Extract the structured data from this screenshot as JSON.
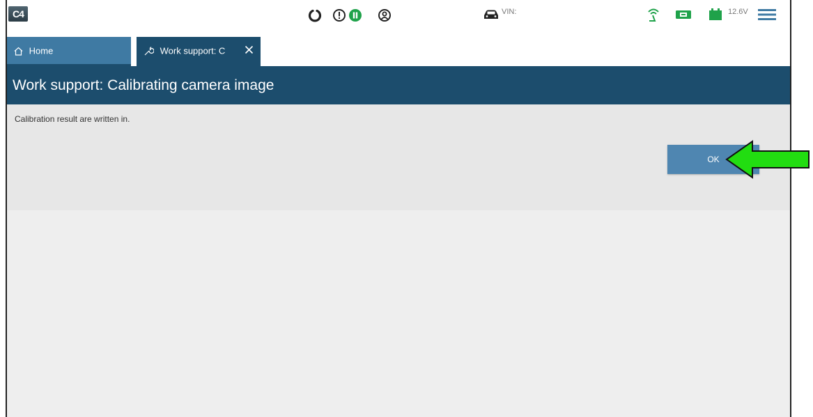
{
  "header": {
    "logo_text": "C4",
    "vin_label": "VIN:",
    "voltage": "12.6V",
    "icons": [
      "refresh-icon",
      "alert-icon",
      "pause-icon",
      "user-icon",
      "car-icon",
      "wireless-icon",
      "vi-connection-icon",
      "battery-icon",
      "menu-icon"
    ],
    "accent_green": "#1fa24a"
  },
  "tabs": [
    {
      "label": "Home",
      "icon": "home-icon",
      "active": false
    },
    {
      "label": "Work support: C",
      "icon": "wrench-icon",
      "active": true
    }
  ],
  "page": {
    "title": "Work support: Calibrating camera image",
    "message": "Calibration result are written in.",
    "ok_label": "OK"
  },
  "colors": {
    "title_bar": "#1c4d6d",
    "tab_home": "#3f7aa3",
    "ok_button": "#4f86b1",
    "pointer_arrow": "#22dd11"
  }
}
